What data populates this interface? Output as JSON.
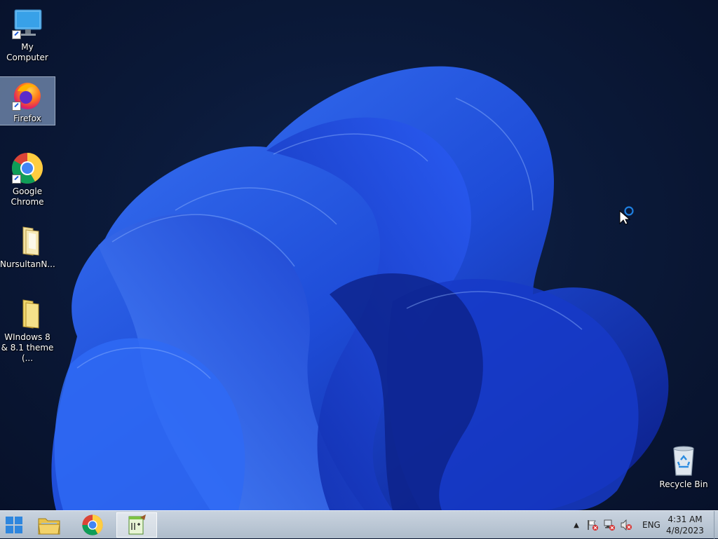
{
  "desktop": {
    "icons": [
      {
        "label": "My Computer",
        "icon": "monitor-icon"
      },
      {
        "label": "Firefox",
        "icon": "firefox-icon"
      },
      {
        "label": "Google Chrome",
        "icon": "chrome-icon"
      },
      {
        "label": "NursultanN...",
        "icon": "folder-icon"
      },
      {
        "label": "WIndows 8 & 8.1 theme (...",
        "icon": "folder-icon"
      },
      {
        "label": "Recycle Bin",
        "icon": "recycle-bin-icon"
      }
    ]
  },
  "taskbar": {
    "buttons": [
      {
        "name": "start",
        "icon": "windows-logo-icon"
      },
      {
        "name": "file-explorer",
        "icon": "folder-icon"
      },
      {
        "name": "chrome",
        "icon": "chrome-icon"
      },
      {
        "name": "notepad-plus-plus",
        "icon": "notepad-plus-plus-icon"
      }
    ],
    "tray": {
      "language": "ENG",
      "time": "4:31 AM",
      "date": "4/8/2023"
    }
  },
  "colors": {
    "wallpaper_dark": "#07112a",
    "bloom_blue": "#1f4fe0",
    "taskbar": "#bcc8d6"
  }
}
